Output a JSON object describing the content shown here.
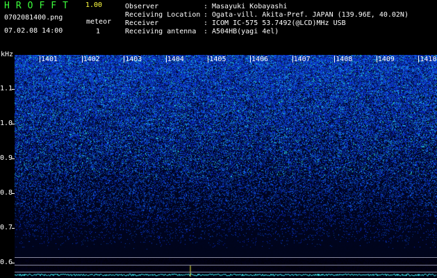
{
  "header": {
    "app_title": "HROFFT",
    "app_version": "1.00",
    "file_name": "0702081400.png",
    "date_time": "07.02.08 14:00",
    "meteor_label": "meteor",
    "meteor_count": "1"
  },
  "info": [
    {
      "key": "Observer",
      "sep": ":",
      "value": "Masayuki Kobayashi"
    },
    {
      "key": "Receiving Location",
      "sep": ":",
      "value": "Ogata-vill. Akita-Pref. JAPAN (139.96E, 40.02N)"
    },
    {
      "key": "Receiver",
      "sep": ":",
      "value": "ICOM IC-575 53.7492(@LCD)MHz USB"
    },
    {
      "key": "Receiving antenna",
      "sep": ":",
      "value": "A504HB(yagi 4el)"
    }
  ],
  "spectrogram": {
    "y_unit": "kHz",
    "y_ticks": [
      "1.1",
      "1.0",
      "0.9",
      "0.8",
      "0.7",
      "0.6"
    ],
    "x_ticks": [
      "1401",
      "1402",
      "1403",
      "1404",
      "1405",
      "1406",
      "1407",
      "1408",
      "1409",
      "1410"
    ],
    "colors": {
      "text": "#ffffff",
      "title": "#3cff3c",
      "version": "#ffff40",
      "noise": "#1428c8",
      "trace": "#40ffff"
    }
  }
}
